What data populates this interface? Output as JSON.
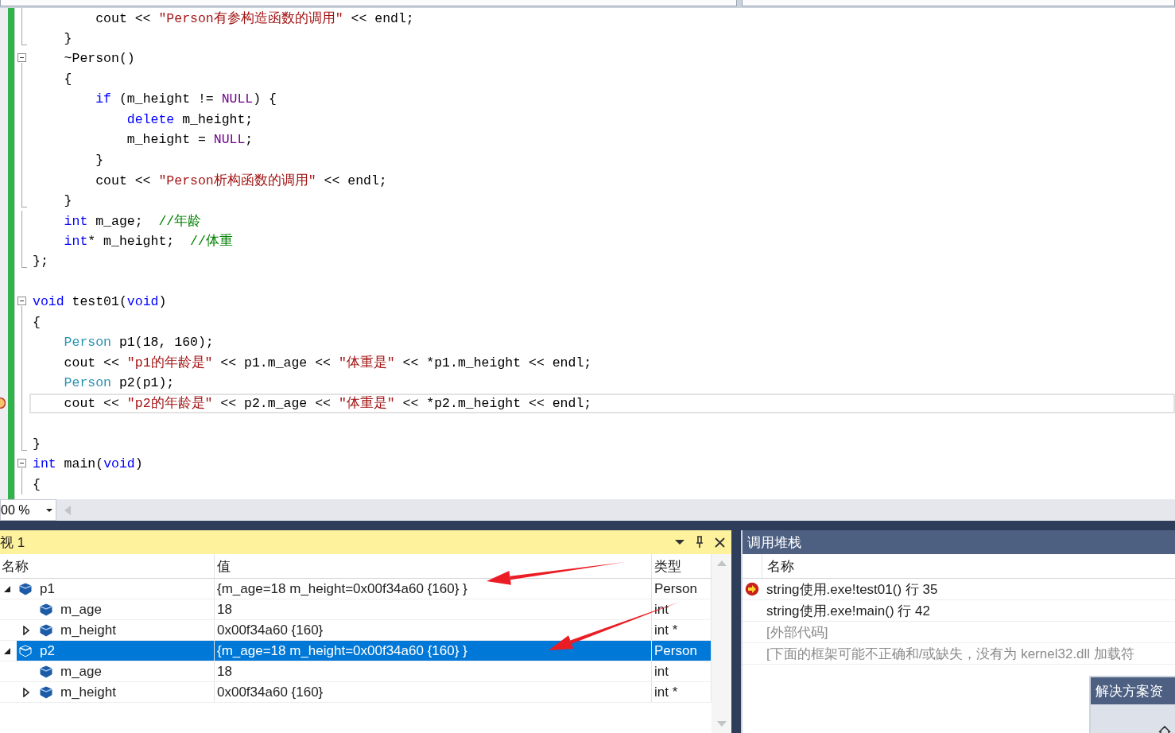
{
  "editor": {
    "lines": [
      {
        "kind": "inner",
        "current": false,
        "tokens": [
          {
            "kind": "plain",
            "text": "        cout << "
          },
          {
            "kind": "string",
            "text": "\"Person有参构造函数的调用\""
          },
          {
            "kind": "plain",
            "text": " << endl;"
          }
        ]
      },
      {
        "kind": "end",
        "current": false,
        "tokens": [
          {
            "kind": "plain",
            "text": "    }"
          }
        ]
      },
      {
        "kind": "start",
        "current": false,
        "tokens": [
          {
            "kind": "plain",
            "text": "    ~Person()"
          }
        ]
      },
      {
        "kind": "inner",
        "current": false,
        "tokens": [
          {
            "kind": "plain",
            "text": "    {"
          }
        ]
      },
      {
        "kind": "inner",
        "current": false,
        "tokens": [
          {
            "kind": "keyword",
            "text": "        if"
          },
          {
            "kind": "plain",
            "text": " (m_height != "
          },
          {
            "kind": "macro",
            "text": "NULL"
          },
          {
            "kind": "plain",
            "text": ") {"
          }
        ]
      },
      {
        "kind": "inner",
        "current": false,
        "tokens": [
          {
            "kind": "keyword",
            "text": "            delete"
          },
          {
            "kind": "plain",
            "text": " m_height;"
          }
        ]
      },
      {
        "kind": "inner",
        "current": false,
        "tokens": [
          {
            "kind": "plain",
            "text": "            m_height = "
          },
          {
            "kind": "macro",
            "text": "NULL"
          },
          {
            "kind": "plain",
            "text": ";"
          }
        ]
      },
      {
        "kind": "inner",
        "current": false,
        "tokens": [
          {
            "kind": "plain",
            "text": "        }"
          }
        ]
      },
      {
        "kind": "inner",
        "current": false,
        "tokens": [
          {
            "kind": "plain",
            "text": "        cout << "
          },
          {
            "kind": "string",
            "text": "\"Person析构函数的调用\""
          },
          {
            "kind": "plain",
            "text": " << endl;"
          }
        ]
      },
      {
        "kind": "end",
        "current": false,
        "tokens": [
          {
            "kind": "plain",
            "text": "    }"
          }
        ]
      },
      {
        "kind": "inner",
        "current": false,
        "tokens": [
          {
            "kind": "keyword",
            "text": "    int"
          },
          {
            "kind": "plain",
            "text": " m_age;  "
          },
          {
            "kind": "comment",
            "text": "//年龄"
          }
        ]
      },
      {
        "kind": "inner",
        "current": false,
        "tokens": [
          {
            "kind": "keyword",
            "text": "    int"
          },
          {
            "kind": "plain",
            "text": "* m_height;  "
          },
          {
            "kind": "comment",
            "text": "//体重"
          }
        ]
      },
      {
        "kind": "end",
        "current": false,
        "tokens": [
          {
            "kind": "plain",
            "text": "};"
          }
        ]
      },
      {
        "kind": "none",
        "current": false
      },
      {
        "kind": "start",
        "current": false,
        "tokens": [
          {
            "kind": "keyword",
            "text": "void"
          },
          {
            "kind": "plain",
            "text": " test01("
          },
          {
            "kind": "keyword",
            "text": "void"
          },
          {
            "kind": "plain",
            "text": ")"
          }
        ]
      },
      {
        "kind": "inner",
        "current": false,
        "tokens": [
          {
            "kind": "plain",
            "text": "{"
          }
        ]
      },
      {
        "kind": "inner",
        "current": false,
        "tokens": [
          {
            "kind": "type",
            "text": "    Person"
          },
          {
            "kind": "plain",
            "text": " p1(18, 160);"
          }
        ]
      },
      {
        "kind": "inner",
        "current": false,
        "tokens": [
          {
            "kind": "plain",
            "text": "    cout << "
          },
          {
            "kind": "string",
            "text": "\"p1的年龄是\""
          },
          {
            "kind": "plain",
            "text": " << p1.m_age << "
          },
          {
            "kind": "string",
            "text": "\"体重是\""
          },
          {
            "kind": "plain",
            "text": " << *p1.m_height << endl;"
          }
        ]
      },
      {
        "kind": "inner",
        "current": false,
        "tokens": [
          {
            "kind": "type",
            "text": "    Person"
          },
          {
            "kind": "plain",
            "text": " p2(p1);"
          }
        ]
      },
      {
        "kind": "inner",
        "current": true,
        "tokens": [
          {
            "kind": "plain",
            "text": "    cout << "
          },
          {
            "kind": "string",
            "text": "\"p2的年龄是\""
          },
          {
            "kind": "plain",
            "text": " << p2.m_age << "
          },
          {
            "kind": "string",
            "text": "\"体重是\""
          },
          {
            "kind": "plain",
            "text": " << *p2.m_height << endl;"
          }
        ]
      },
      {
        "kind": "inner",
        "current": false
      },
      {
        "kind": "end",
        "current": false,
        "tokens": [
          {
            "kind": "plain",
            "text": "}"
          }
        ]
      },
      {
        "kind": "start",
        "current": false,
        "tokens": [
          {
            "kind": "keyword",
            "text": "int"
          },
          {
            "kind": "plain",
            "text": " main("
          },
          {
            "kind": "keyword",
            "text": "void"
          },
          {
            "kind": "plain",
            "text": ")"
          }
        ]
      },
      {
        "kind": "inner",
        "current": false,
        "tokens": [
          {
            "kind": "plain",
            "text": "{"
          }
        ]
      }
    ]
  },
  "zoom": {
    "value": "00 %"
  },
  "watch": {
    "title": "视 1",
    "columns": [
      "名称",
      "值",
      "类型"
    ],
    "rows": [
      {
        "name": "p1",
        "value": "{m_age=18 m_height=0x00f34a60 {160} }",
        "type": "Person",
        "selected": false,
        "expanded": true,
        "children": [
          {
            "name": "m_age",
            "value": "18",
            "type": "int",
            "selected": false
          },
          {
            "name": "m_height",
            "value": "0x00f34a60 {160}",
            "type": "int *",
            "selected": false,
            "expanded": false
          }
        ]
      },
      {
        "name": "p2",
        "value": "{m_age=18 m_height=0x00f34a60 {160} }",
        "type": "Person",
        "selected": true,
        "expanded": true,
        "children": [
          {
            "name": "m_age",
            "value": "18",
            "type": "int",
            "selected": false
          },
          {
            "name": "m_height",
            "value": "0x00f34a60 {160}",
            "type": "int *",
            "selected": false,
            "expanded": false
          }
        ]
      }
    ]
  },
  "call_stack": {
    "title": "调用堆栈",
    "columns": [
      "名称"
    ],
    "rows": [
      {
        "text": "string使用.exe!test01() 行 35",
        "current": true,
        "external": false
      },
      {
        "text": "string使用.exe!main() 行 42",
        "current": false,
        "external": false
      },
      {
        "text": "[外部代码]",
        "current": false,
        "external": true
      },
      {
        "text": "[下面的框架可能不正确和/或缺失，没有为 kernel32.dll 加载符",
        "current": false,
        "external": true
      }
    ]
  },
  "solution_explorer": {
    "title": "解决方案资"
  }
}
